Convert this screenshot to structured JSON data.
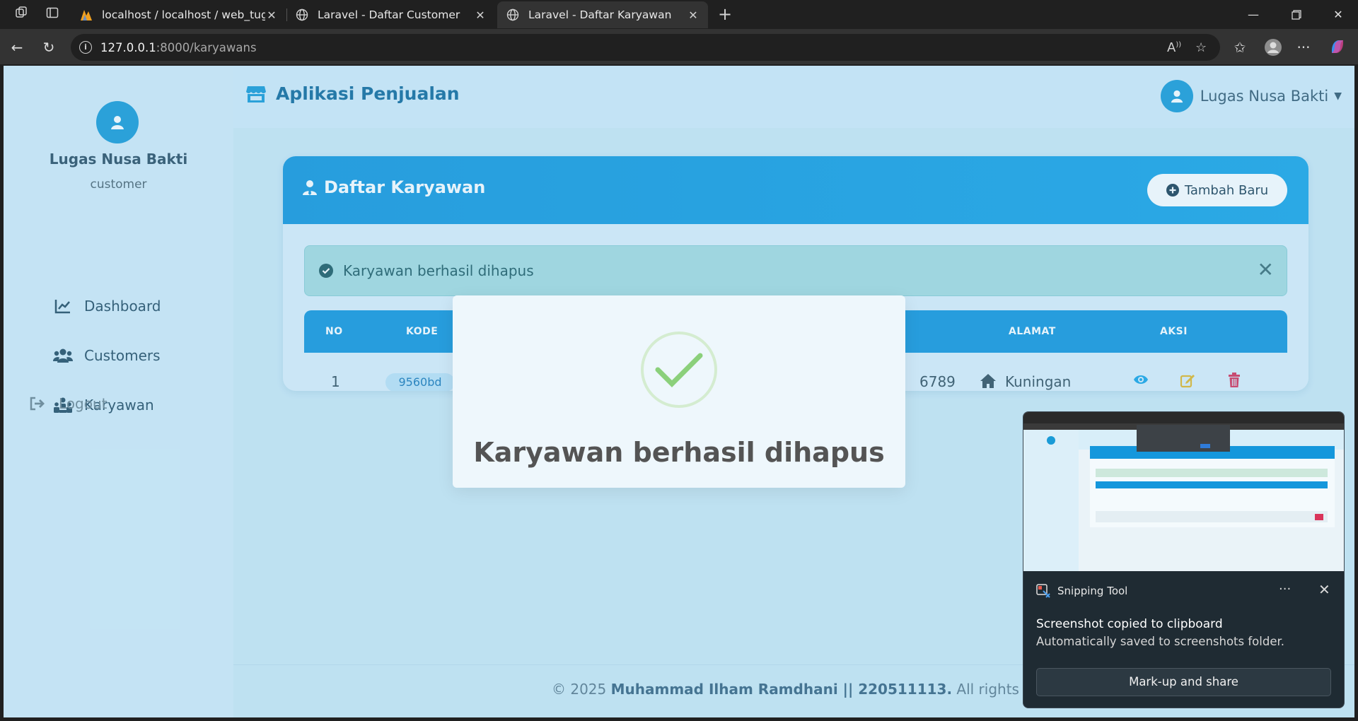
{
  "browser": {
    "tabs": [
      {
        "title": "localhost / localhost / web_tugas",
        "active": false
      },
      {
        "title": "Laravel - Daftar Customer",
        "active": false
      },
      {
        "title": "Laravel - Daftar Karyawan",
        "active": true
      }
    ],
    "url_host": "127.0.0.1",
    "url_rest": ":8000/karyawans"
  },
  "app": {
    "brand": "Aplikasi Penjualan",
    "header_user": "Lugas Nusa Bakti"
  },
  "sidebar": {
    "name": "Lugas Nusa Bakti",
    "role": "customer",
    "items": [
      {
        "label": "Dashboard",
        "icon": "chart-line-icon"
      },
      {
        "label": "Customers",
        "icon": "users-icon"
      },
      {
        "label": "Karyawan",
        "icon": "people-group-icon"
      }
    ],
    "logout": "Logout"
  },
  "card": {
    "title": "Daftar Karyawan",
    "add_button": "Tambah Baru"
  },
  "alert": {
    "message": "Karyawan berhasil dihapus"
  },
  "table": {
    "headers": {
      "no": "NO",
      "kode": "KODE",
      "alamat": "ALAMAT",
      "aksi": "AKSI"
    },
    "rows": [
      {
        "no": "1",
        "kode": "9560bd",
        "phone_partial": "6789",
        "alamat": "Kuningan"
      }
    ]
  },
  "modal": {
    "message": "Karyawan berhasil dihapus"
  },
  "footer": {
    "prefix": "© 2025 ",
    "author": "Muhammad Ilham Ramdhani || 220511113.",
    "suffix": " All rights reserve"
  },
  "toast": {
    "app": "Snipping Tool",
    "title": "Screenshot copied to clipboard",
    "subtitle": "Automatically saved to screenshots folder.",
    "button": "Mark-up and share"
  },
  "colors": {
    "primary": "#1597dc",
    "alert_bg": "#a8dce0",
    "success_check": "#8bd07b",
    "delete": "#d9345a",
    "edit": "#e5b82a"
  }
}
